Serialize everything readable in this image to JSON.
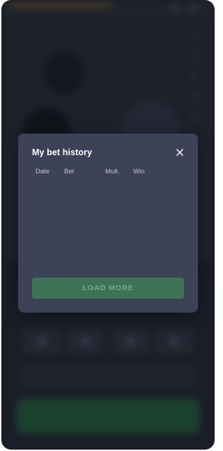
{
  "modal": {
    "title": "My bet history",
    "columns": [
      "Date",
      "Bet",
      "Mult.",
      "Win"
    ],
    "rows": [],
    "load_more_label": "LOAD MORE"
  },
  "icons": {
    "close": "close-icon"
  },
  "colors": {
    "modal_background": "#3e4257",
    "load_more_button": "#3f7358",
    "load_more_text": "#7fa592",
    "title_text": "#ffffff",
    "header_text": "#c3c7d6",
    "app_background": "#1c1f29"
  }
}
